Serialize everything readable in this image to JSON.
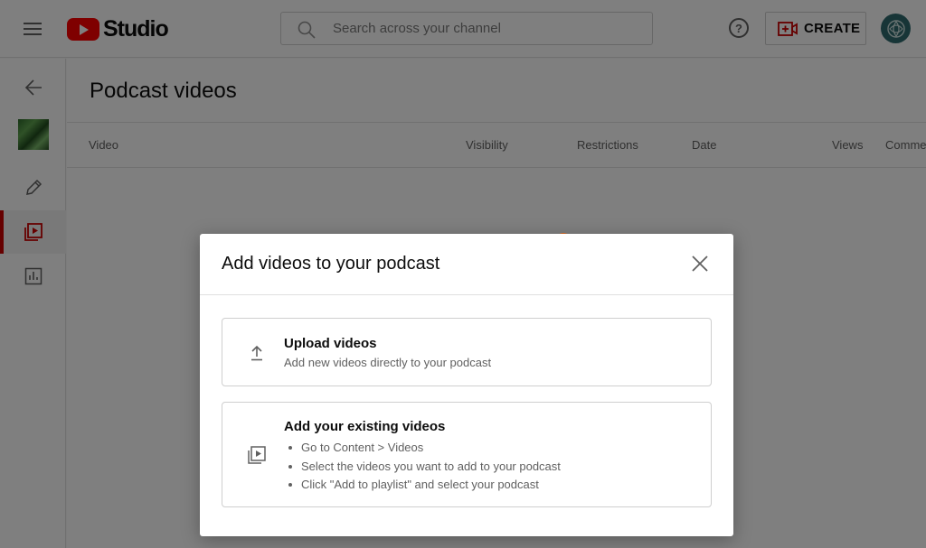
{
  "header": {
    "brand": "Studio",
    "search_placeholder": "Search across your channel",
    "help_label": "?",
    "create_label": "CREATE"
  },
  "main": {
    "title": "Podcast videos",
    "columns": [
      "Video",
      "Visibility",
      "Restrictions",
      "Date",
      "Views",
      "Comments"
    ]
  },
  "dialog": {
    "title": "Add videos to your podcast",
    "upload": {
      "title": "Upload videos",
      "description": "Add new videos directly to your podcast"
    },
    "existing": {
      "title": "Add your existing videos",
      "steps": [
        "Go to Content > Videos",
        "Select the videos you want to add to your podcast",
        "Click \"Add to playlist\" and select your podcast"
      ]
    }
  },
  "colors": {
    "brand_red": "#ff0000",
    "active_accent": "#cc0000",
    "avatar": "#2f6a6f",
    "spinner": "#e2691d"
  },
  "icons": {
    "menu": "hamburger-icon",
    "search": "search-icon",
    "help": "help-icon",
    "create": "video-camera-plus-icon",
    "back": "arrow-left-icon",
    "edit": "pencil-icon",
    "content": "video-library-icon",
    "analytics": "bar-chart-icon",
    "close": "close-icon",
    "upload": "upload-arrow-icon",
    "existing": "playlist-play-icon"
  }
}
